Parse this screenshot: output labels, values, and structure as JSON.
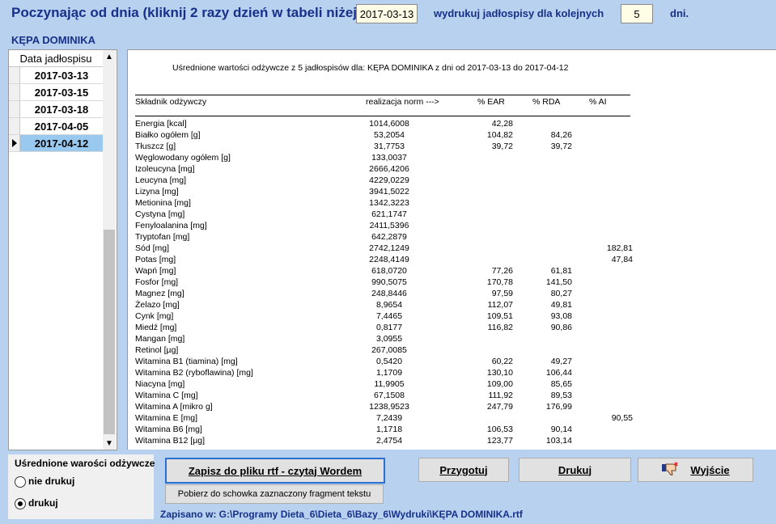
{
  "header": {
    "title": "Poczynając od dnia (kliknij 2 razy dzień w tabeli niżej):",
    "start_date": "2017-03-13",
    "print_label": "wydrukuj jadłospisy dla kolejnych",
    "days_value": "5",
    "days_unit": "dni."
  },
  "patient": "KĘPA DOMINIKA",
  "date_list": {
    "header": "Data jadłospisu",
    "items": [
      "2017-03-13",
      "2017-03-15",
      "2017-03-18",
      "2017-04-05",
      "2017-04-12"
    ],
    "selected_index": 4
  },
  "report": {
    "heading": "Uśrednione wartości odżywcze z 5 jadłospisów dla:  KĘPA DOMINIKA z dni od 2017-03-13 do 2017-04-12",
    "columns": {
      "name": "Składnik odżywczy",
      "value": "realizacja norm --->",
      "ear": "% EAR",
      "rda": "% RDA",
      "ai": "% AI"
    },
    "rows": [
      {
        "name": "Energia [kcal]",
        "value": "1014,6008",
        "ear": "42,28",
        "rda": "",
        "ai": ""
      },
      {
        "name": "Białko ogółem [g]",
        "value": "53,2054",
        "ear": "104,82",
        "rda": "84,26",
        "ai": ""
      },
      {
        "name": "Tłuszcz [g]",
        "value": "31,7753",
        "ear": "39,72",
        "rda": "39,72",
        "ai": ""
      },
      {
        "name": "Węglowodany ogółem [g]",
        "value": "133,0037",
        "ear": "",
        "rda": "",
        "ai": ""
      },
      {
        "name": "Izoleucyna [mg]",
        "value": "2666,4206",
        "ear": "",
        "rda": "",
        "ai": ""
      },
      {
        "name": "Leucyna [mg]",
        "value": "4229,0229",
        "ear": "",
        "rda": "",
        "ai": ""
      },
      {
        "name": "Lizyna [mg]",
        "value": "3941,5022",
        "ear": "",
        "rda": "",
        "ai": ""
      },
      {
        "name": "Metionina [mg]",
        "value": "1342,3223",
        "ear": "",
        "rda": "",
        "ai": ""
      },
      {
        "name": "Cystyna [mg]",
        "value": "621,1747",
        "ear": "",
        "rda": "",
        "ai": ""
      },
      {
        "name": "Fenyloalanina [mg]",
        "value": "2411,5396",
        "ear": "",
        "rda": "",
        "ai": ""
      },
      {
        "name": "Tryptofan [mg]",
        "value": "642,2879",
        "ear": "",
        "rda": "",
        "ai": ""
      },
      {
        "name": "Sód [mg]",
        "value": "2742,1249",
        "ear": "",
        "rda": "",
        "ai": "182,81"
      },
      {
        "name": "Potas [mg]",
        "value": "2248,4149",
        "ear": "",
        "rda": "",
        "ai": "47,84"
      },
      {
        "name": "Wapń [mg]",
        "value": "618,0720",
        "ear": "77,26",
        "rda": "61,81",
        "ai": ""
      },
      {
        "name": "Fosfor [mg]",
        "value": "990,5075",
        "ear": "170,78",
        "rda": "141,50",
        "ai": ""
      },
      {
        "name": "Magnez [mg]",
        "value": "248,8446",
        "ear": "97,59",
        "rda": "80,27",
        "ai": ""
      },
      {
        "name": "Żelazo [mg]",
        "value": "8,9654",
        "ear": "112,07",
        "rda": "49,81",
        "ai": ""
      },
      {
        "name": "Cynk [mg]",
        "value": "7,4465",
        "ear": "109,51",
        "rda": "93,08",
        "ai": ""
      },
      {
        "name": "Miedź [mg]",
        "value": "0,8177",
        "ear": "116,82",
        "rda": "90,86",
        "ai": ""
      },
      {
        "name": "Mangan [mg]",
        "value": "3,0955",
        "ear": "",
        "rda": "",
        "ai": ""
      },
      {
        "name": "Retinol [µg]",
        "value": "267,0085",
        "ear": "",
        "rda": "",
        "ai": ""
      },
      {
        "name": "Witamina B1 (tiamina) [mg]",
        "value": "0,5420",
        "ear": "60,22",
        "rda": "49,27",
        "ai": ""
      },
      {
        "name": "Witamina B2 (ryboflawina) [mg]",
        "value": "1,1709",
        "ear": "130,10",
        "rda": "106,44",
        "ai": ""
      },
      {
        "name": "Niacyna [mg]",
        "value": "11,9905",
        "ear": "109,00",
        "rda": "85,65",
        "ai": ""
      },
      {
        "name": "Witamina C [mg]",
        "value": "67,1508",
        "ear": "111,92",
        "rda": "89,53",
        "ai": ""
      },
      {
        "name": "Witamina A [mikro g]",
        "value": "1238,9523",
        "ear": "247,79",
        "rda": "176,99",
        "ai": ""
      },
      {
        "name": "Witamina E [mg]",
        "value": "7,2439",
        "ear": "",
        "rda": "",
        "ai": "90,55"
      },
      {
        "name": "Witamina B6 [mg]",
        "value": "1,1718",
        "ear": "106,53",
        "rda": "90,14",
        "ai": ""
      },
      {
        "name": "Witamina B12 [µg]",
        "value": "2,4754",
        "ear": "123,77",
        "rda": "103,14",
        "ai": ""
      }
    ]
  },
  "options": {
    "title": "Uśrednione warości odżywcze",
    "opt_no_print": "nie drukuj",
    "opt_print": "drukuj",
    "selected": "drukuj"
  },
  "buttons": {
    "save_rtf": "Zapisz do pliku rtf - czytaj Wordem",
    "prepare": "Przygotuj",
    "print": "Drukuj",
    "exit": "Wyjście",
    "copy_fragment": "Pobierz do schowka zaznaczony fragment tekstu"
  },
  "status": "Zapisano w: G:\\Programy Dieta_6\\Dieta_6\\Bazy_6\\Wydruki\\KĘPA DOMINIKA.rtf"
}
